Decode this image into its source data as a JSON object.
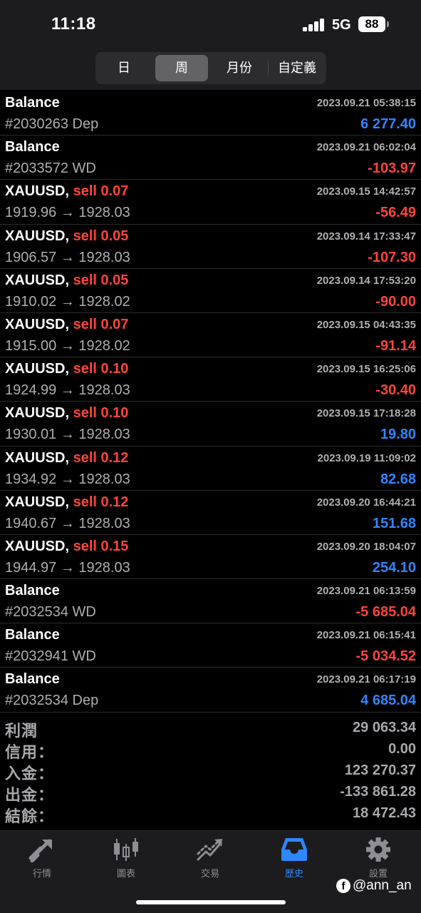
{
  "status_bar": {
    "time": "11:18",
    "network": "5G",
    "battery": "88"
  },
  "period_tabs": [
    {
      "label": "日",
      "active": false
    },
    {
      "label": "周",
      "active": true
    },
    {
      "label": "月份",
      "active": false
    },
    {
      "label": "自定義",
      "active": false
    }
  ],
  "deals": [
    {
      "kind": "balance",
      "title": "Balance",
      "side": "",
      "detail": "#2030263 Dep",
      "date": "2023.09.21 05:38:15",
      "amount": "6 277.40",
      "sign": "pos"
    },
    {
      "kind": "balance",
      "title": "Balance",
      "side": "",
      "detail": "#2033572 WD",
      "date": "2023.09.21 06:02:04",
      "amount": "-103.97",
      "sign": "neg"
    },
    {
      "kind": "trade",
      "title": "XAUUSD,",
      "side": "sell 0.07",
      "detail": "1919.96 → 1928.03",
      "date": "2023.09.15 14:42:57",
      "amount": "-56.49",
      "sign": "neg"
    },
    {
      "kind": "trade",
      "title": "XAUUSD,",
      "side": "sell 0.05",
      "detail": "1906.57 → 1928.03",
      "date": "2023.09.14 17:33:47",
      "amount": "-107.30",
      "sign": "neg"
    },
    {
      "kind": "trade",
      "title": "XAUUSD,",
      "side": "sell 0.05",
      "detail": "1910.02 → 1928.02",
      "date": "2023.09.14 17:53:20",
      "amount": "-90.00",
      "sign": "neg"
    },
    {
      "kind": "trade",
      "title": "XAUUSD,",
      "side": "sell 0.07",
      "detail": "1915.00 → 1928.02",
      "date": "2023.09.15 04:43:35",
      "amount": "-91.14",
      "sign": "neg"
    },
    {
      "kind": "trade",
      "title": "XAUUSD,",
      "side": "sell 0.10",
      "detail": "1924.99 → 1928.03",
      "date": "2023.09.15 16:25:06",
      "amount": "-30.40",
      "sign": "neg"
    },
    {
      "kind": "trade",
      "title": "XAUUSD,",
      "side": "sell 0.10",
      "detail": "1930.01 → 1928.03",
      "date": "2023.09.15 17:18:28",
      "amount": "19.80",
      "sign": "pos"
    },
    {
      "kind": "trade",
      "title": "XAUUSD,",
      "side": "sell 0.12",
      "detail": "1934.92 → 1928.03",
      "date": "2023.09.19 11:09:02",
      "amount": "82.68",
      "sign": "pos"
    },
    {
      "kind": "trade",
      "title": "XAUUSD,",
      "side": "sell 0.12",
      "detail": "1940.67 → 1928.03",
      "date": "2023.09.20 16:44:21",
      "amount": "151.68",
      "sign": "pos"
    },
    {
      "kind": "trade",
      "title": "XAUUSD,",
      "side": "sell 0.15",
      "detail": "1944.97 → 1928.03",
      "date": "2023.09.20 18:04:07",
      "amount": "254.10",
      "sign": "pos"
    },
    {
      "kind": "balance",
      "title": "Balance",
      "side": "",
      "detail": "#2032534 WD",
      "date": "2023.09.21 06:13:59",
      "amount": "-5 685.04",
      "sign": "neg"
    },
    {
      "kind": "balance",
      "title": "Balance",
      "side": "",
      "detail": "#2032941 WD",
      "date": "2023.09.21 06:15:41",
      "amount": "-5 034.52",
      "sign": "neg"
    },
    {
      "kind": "balance",
      "title": "Balance",
      "side": "",
      "detail": "#2032534 Dep",
      "date": "2023.09.21 06:17:19",
      "amount": "4 685.04",
      "sign": "pos"
    }
  ],
  "summary": [
    {
      "label": "利潤",
      "value": "29 063.34"
    },
    {
      "label": "信用：",
      "value": "0.00"
    },
    {
      "label": "入金：",
      "value": "123 270.37"
    },
    {
      "label": "出金：",
      "value": "-133 861.28"
    },
    {
      "label": "結餘：",
      "value": "18 472.43"
    }
  ],
  "tabbar": [
    {
      "label": "行情",
      "icon": "quotes-icon",
      "active": false
    },
    {
      "label": "圖表",
      "icon": "candlestick-chart-icon",
      "active": false
    },
    {
      "label": "交易",
      "icon": "trade-icon",
      "active": false
    },
    {
      "label": "歷史",
      "icon": "history-inbox-icon",
      "active": true
    },
    {
      "label": "設置",
      "icon": "gear-icon",
      "active": false
    }
  ],
  "watermark": {
    "text": "@ann_an",
    "icon": "facebook-icon"
  },
  "colors": {
    "positive": "#2f86ff",
    "negative": "#ff453a",
    "active_tab": "#2f86ff"
  }
}
